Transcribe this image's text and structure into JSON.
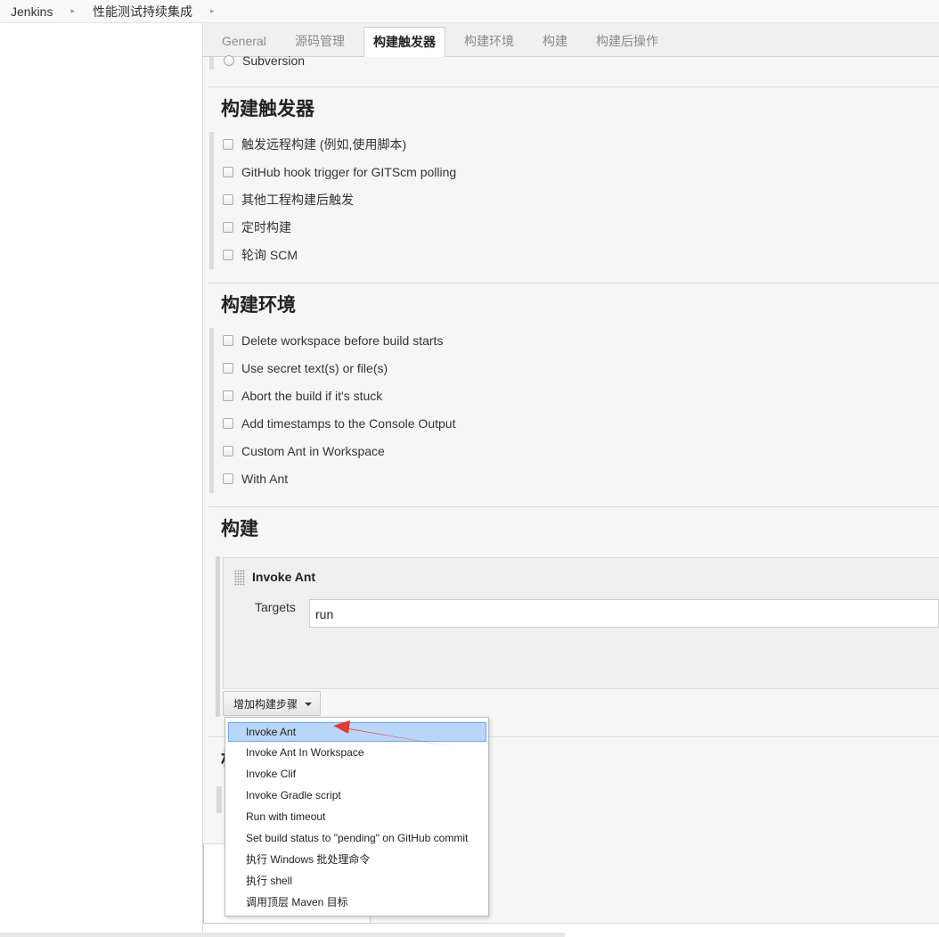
{
  "breadcrumb": {
    "root": "Jenkins",
    "project": "性能测试持续集成"
  },
  "tabs": [
    {
      "label": "General"
    },
    {
      "label": "源码管理"
    },
    {
      "label": "构建触发器"
    },
    {
      "label": "构建环境"
    },
    {
      "label": "构建"
    },
    {
      "label": "构建后操作"
    }
  ],
  "scm": {
    "subversion_label": "Subversion"
  },
  "triggers": {
    "title": "构建触发器",
    "items": [
      {
        "label": "触发远程构建 (例如,使用脚本)"
      },
      {
        "label": "GitHub hook trigger for GITScm polling"
      },
      {
        "label": "其他工程构建后触发"
      },
      {
        "label": "定时构建"
      },
      {
        "label": "轮询 SCM"
      }
    ]
  },
  "environment": {
    "title": "构建环境",
    "items": [
      {
        "label": "Delete workspace before build starts"
      },
      {
        "label": "Use secret text(s) or file(s)"
      },
      {
        "label": "Abort the build if it's stuck"
      },
      {
        "label": "Add timestamps to the Console Output"
      },
      {
        "label": "Custom Ant in Workspace"
      },
      {
        "label": "With Ant"
      }
    ]
  },
  "build": {
    "title": "构建",
    "step": {
      "title": "Invoke Ant",
      "targets_label": "Targets",
      "targets_value": "run"
    },
    "add_step_label": "增加构建步骤",
    "menu": [
      {
        "label": "Invoke Ant"
      },
      {
        "label": "Invoke Ant In Workspace"
      },
      {
        "label": "Invoke Clif"
      },
      {
        "label": "Invoke Gradle script"
      },
      {
        "label": "Run with timeout"
      },
      {
        "label": "Set build status to \"pending\" on GitHub commit"
      },
      {
        "label": "执行 Windows 批处理命令"
      },
      {
        "label": "执行 shell"
      },
      {
        "label": "调用顶层 Maven 目标"
      }
    ]
  },
  "post_build": {
    "title_fragment": "构"
  },
  "colors": {
    "highlight": "#b9d5f8",
    "highlight_border": "#6aa6ee",
    "annotation": "#e53935"
  }
}
